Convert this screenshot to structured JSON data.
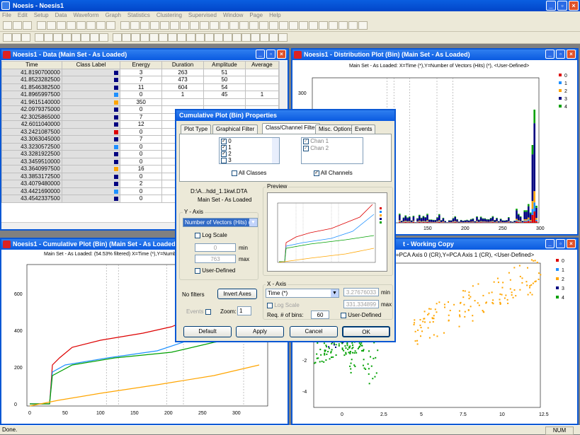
{
  "app": {
    "title": "Noesis - Noesis1"
  },
  "menu": [
    "File",
    "Edit",
    "Setup",
    "Data",
    "Waveform",
    "Graph",
    "Statistics",
    "Clustering",
    "Supervised",
    "Window",
    "Page",
    "Help"
  ],
  "data_window": {
    "title": "Noesis1 - Data (Main Set - As Loaded)",
    "columns": [
      "Time",
      "Class Label",
      "Energy",
      "Duration",
      "Amplitude",
      "Average"
    ],
    "rows": [
      [
        "41.8190700000",
        "#000080",
        "3",
        "263",
        "51",
        ""
      ],
      [
        "41.8523282500",
        "#000080",
        "7",
        "473",
        "50",
        ""
      ],
      [
        "41.8546382500",
        "#000080",
        "11",
        "604",
        "54",
        ""
      ],
      [
        "41.8965997500",
        "#1e90ff",
        "0",
        "1",
        "45",
        "1"
      ],
      [
        "41.9615140000",
        "#ffa500",
        "350",
        "",
        "",
        ""
      ],
      [
        "42.0979375000",
        "#000080",
        "0",
        "",
        "",
        ""
      ],
      [
        "42.3025865000",
        "#000080",
        "7",
        "",
        "",
        ""
      ],
      [
        "42.6011040000",
        "#000080",
        "12",
        "",
        "",
        ""
      ],
      [
        "43.2421087500",
        "#dd0000",
        "0",
        "",
        "",
        ""
      ],
      [
        "43.3063045000",
        "#000080",
        "7",
        "",
        "",
        ""
      ],
      [
        "43.3230572500",
        "#1e90ff",
        "0",
        "",
        "",
        ""
      ],
      [
        "43.3281922500",
        "#000080",
        "0",
        "",
        "",
        ""
      ],
      [
        "43.3459510000",
        "#000080",
        "0",
        "",
        "",
        ""
      ],
      [
        "43.3640997500",
        "#ffa500",
        "16",
        "",
        "",
        ""
      ],
      [
        "43.3853172500",
        "#000080",
        "0",
        "",
        "",
        ""
      ],
      [
        "43.4079480000",
        "#000080",
        "2",
        "",
        "",
        ""
      ],
      [
        "43.4421690000",
        "#1e90ff",
        "0",
        "",
        "",
        ""
      ],
      [
        "43.4542337500",
        "#000080",
        "0",
        "",
        "",
        ""
      ]
    ]
  },
  "dist_window": {
    "title": "Noesis1 - Distribution Plot (Bin) (Main Set - As Loaded)",
    "subtitle": "Main Set - As Loaded: X=Time (*),Y=Number of Vectors (Hits) (*), <User-Defined>",
    "legend": [
      "0",
      "1",
      "2",
      "3",
      "4"
    ],
    "ytick": "300",
    "xticks": [
      "150",
      "200",
      "250",
      "300"
    ]
  },
  "cum_window": {
    "title": "Noesis1 - Cumulative Plot (Bin) (Main Set - As Loaded)",
    "subtitle": "Main Set - As Loaded: (54.53% filtered) X=Time (*),Y=Number o",
    "yticks": [
      "600",
      "400",
      "200",
      "0"
    ],
    "xticks": [
      "0",
      "50",
      "100",
      "150",
      "200",
      "250",
      "300"
    ]
  },
  "scatter_window": {
    "title": "t - Working Copy",
    "subtitle": "=PCA Axis 0 (CR),Y=PCA Axis 1 (CR), <User-Defined>",
    "legend": [
      "0",
      "1",
      "2",
      "3",
      "4"
    ],
    "yticks": [
      "-2",
      "-4"
    ],
    "xticks": [
      "0",
      "2.5",
      "5",
      "7.5",
      "10",
      "12.5"
    ]
  },
  "dialog": {
    "title": "Cumulative Plot (Bin) Properties",
    "tabs": [
      "Plot Type",
      "Graphical Filter",
      "Class/Channel Filter",
      "Misc. Options",
      "Events"
    ],
    "classes": [
      "0",
      "1",
      "2",
      "3"
    ],
    "channels": [
      "Chan  1",
      "Chan  2"
    ],
    "all_classes": "All Classes",
    "all_channels": "All Channels",
    "file_line1": "D:\\A...hdd_1.1kwl.DTA",
    "file_line2": "Main Set - As Loaded",
    "preview_label": "Preview",
    "y_axis": {
      "label": "Y - Axis",
      "select": "Number of Vectors (Hits) (*",
      "log_scale": "Log Scale",
      "min_value": "0",
      "min_label": "min",
      "max_value": "763",
      "max_label": "max",
      "user_defined": "User-Defined"
    },
    "x_axis": {
      "label": "X - Axis",
      "select": "Time (*)",
      "log_scale": "Log Scale",
      "min_value": "3.27676033",
      "min_label": "min",
      "max_value": "331.334899",
      "max_label": "max",
      "bins_label": "Req. # of bins:",
      "bins_value": "60",
      "user_defined": "User-Defined"
    },
    "no_filters": "No filters",
    "invert_axes": "Invert Axes",
    "events": "Events",
    "zoom_label": "Zoom:",
    "zoom_value": "1",
    "buttons": {
      "default": "Default",
      "apply": "Apply",
      "cancel": "Cancel",
      "ok": "OK"
    }
  },
  "status": {
    "left": "Done.",
    "right": "NUM"
  },
  "colors": {
    "c0": "#dd0000",
    "c1": "#1e90ff",
    "c2": "#ffa500",
    "c3": "#000080",
    "c4": "#00a000"
  }
}
